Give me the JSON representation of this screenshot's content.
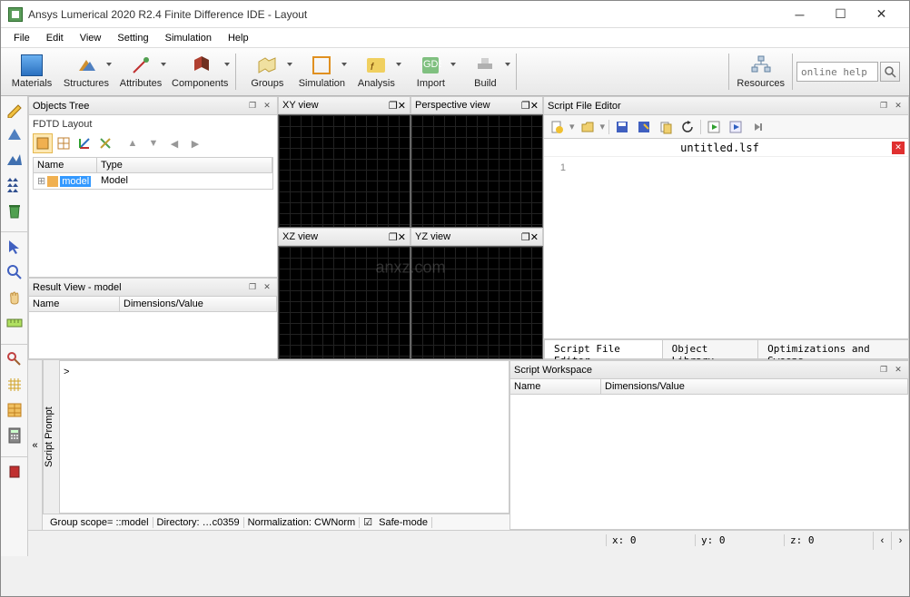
{
  "window": {
    "title": "Ansys Lumerical 2020 R2.4 Finite Difference IDE - Layout"
  },
  "menu": {
    "file": "File",
    "edit": "Edit",
    "view": "View",
    "setting": "Setting",
    "simulation": "Simulation",
    "help": "Help"
  },
  "toolbar": {
    "materials": "Materials",
    "structures": "Structures",
    "attributes": "Attributes",
    "components": "Components",
    "groups": "Groups",
    "simulation": "Simulation",
    "analysis": "Analysis",
    "import": "Import",
    "build": "Build",
    "resources": "Resources",
    "search_placeholder": "online help"
  },
  "panels": {
    "objects_tree": {
      "title": "Objects Tree",
      "subhead": "FDTD Layout",
      "cols": {
        "name": "Name",
        "type": "Type"
      },
      "rows": [
        {
          "name": "model",
          "type": "Model"
        }
      ]
    },
    "result_view": {
      "title": "Result View - model",
      "cols": {
        "name": "Name",
        "dims": "Dimensions/Value"
      }
    },
    "views": {
      "xy": "XY view",
      "persp": "Perspective view",
      "xz": "XZ view",
      "yz": "YZ view"
    },
    "script_editor": {
      "title": "Script File Editor",
      "filename": "untitled.lsf",
      "gutter": "1",
      "tabs": {
        "editor": "Script File Editor",
        "objlib": "Object Library",
        "opts": "Optimizations and Sweeps"
      }
    },
    "script_prompt": {
      "label": "Script Prompt",
      "prompt": ">",
      "status": {
        "scope": "Group scope= ::model",
        "dir": "Directory: …c0359",
        "norm": "Normalization: CWNorm",
        "safe": "Safe-mode"
      }
    },
    "script_ws": {
      "title": "Script Workspace",
      "cols": {
        "name": "Name",
        "dims": "Dimensions/Value"
      }
    }
  },
  "statusbar": {
    "x": "x: 0",
    "y": "y: 0",
    "z": "z: 0"
  },
  "watermark": "anxz.com"
}
